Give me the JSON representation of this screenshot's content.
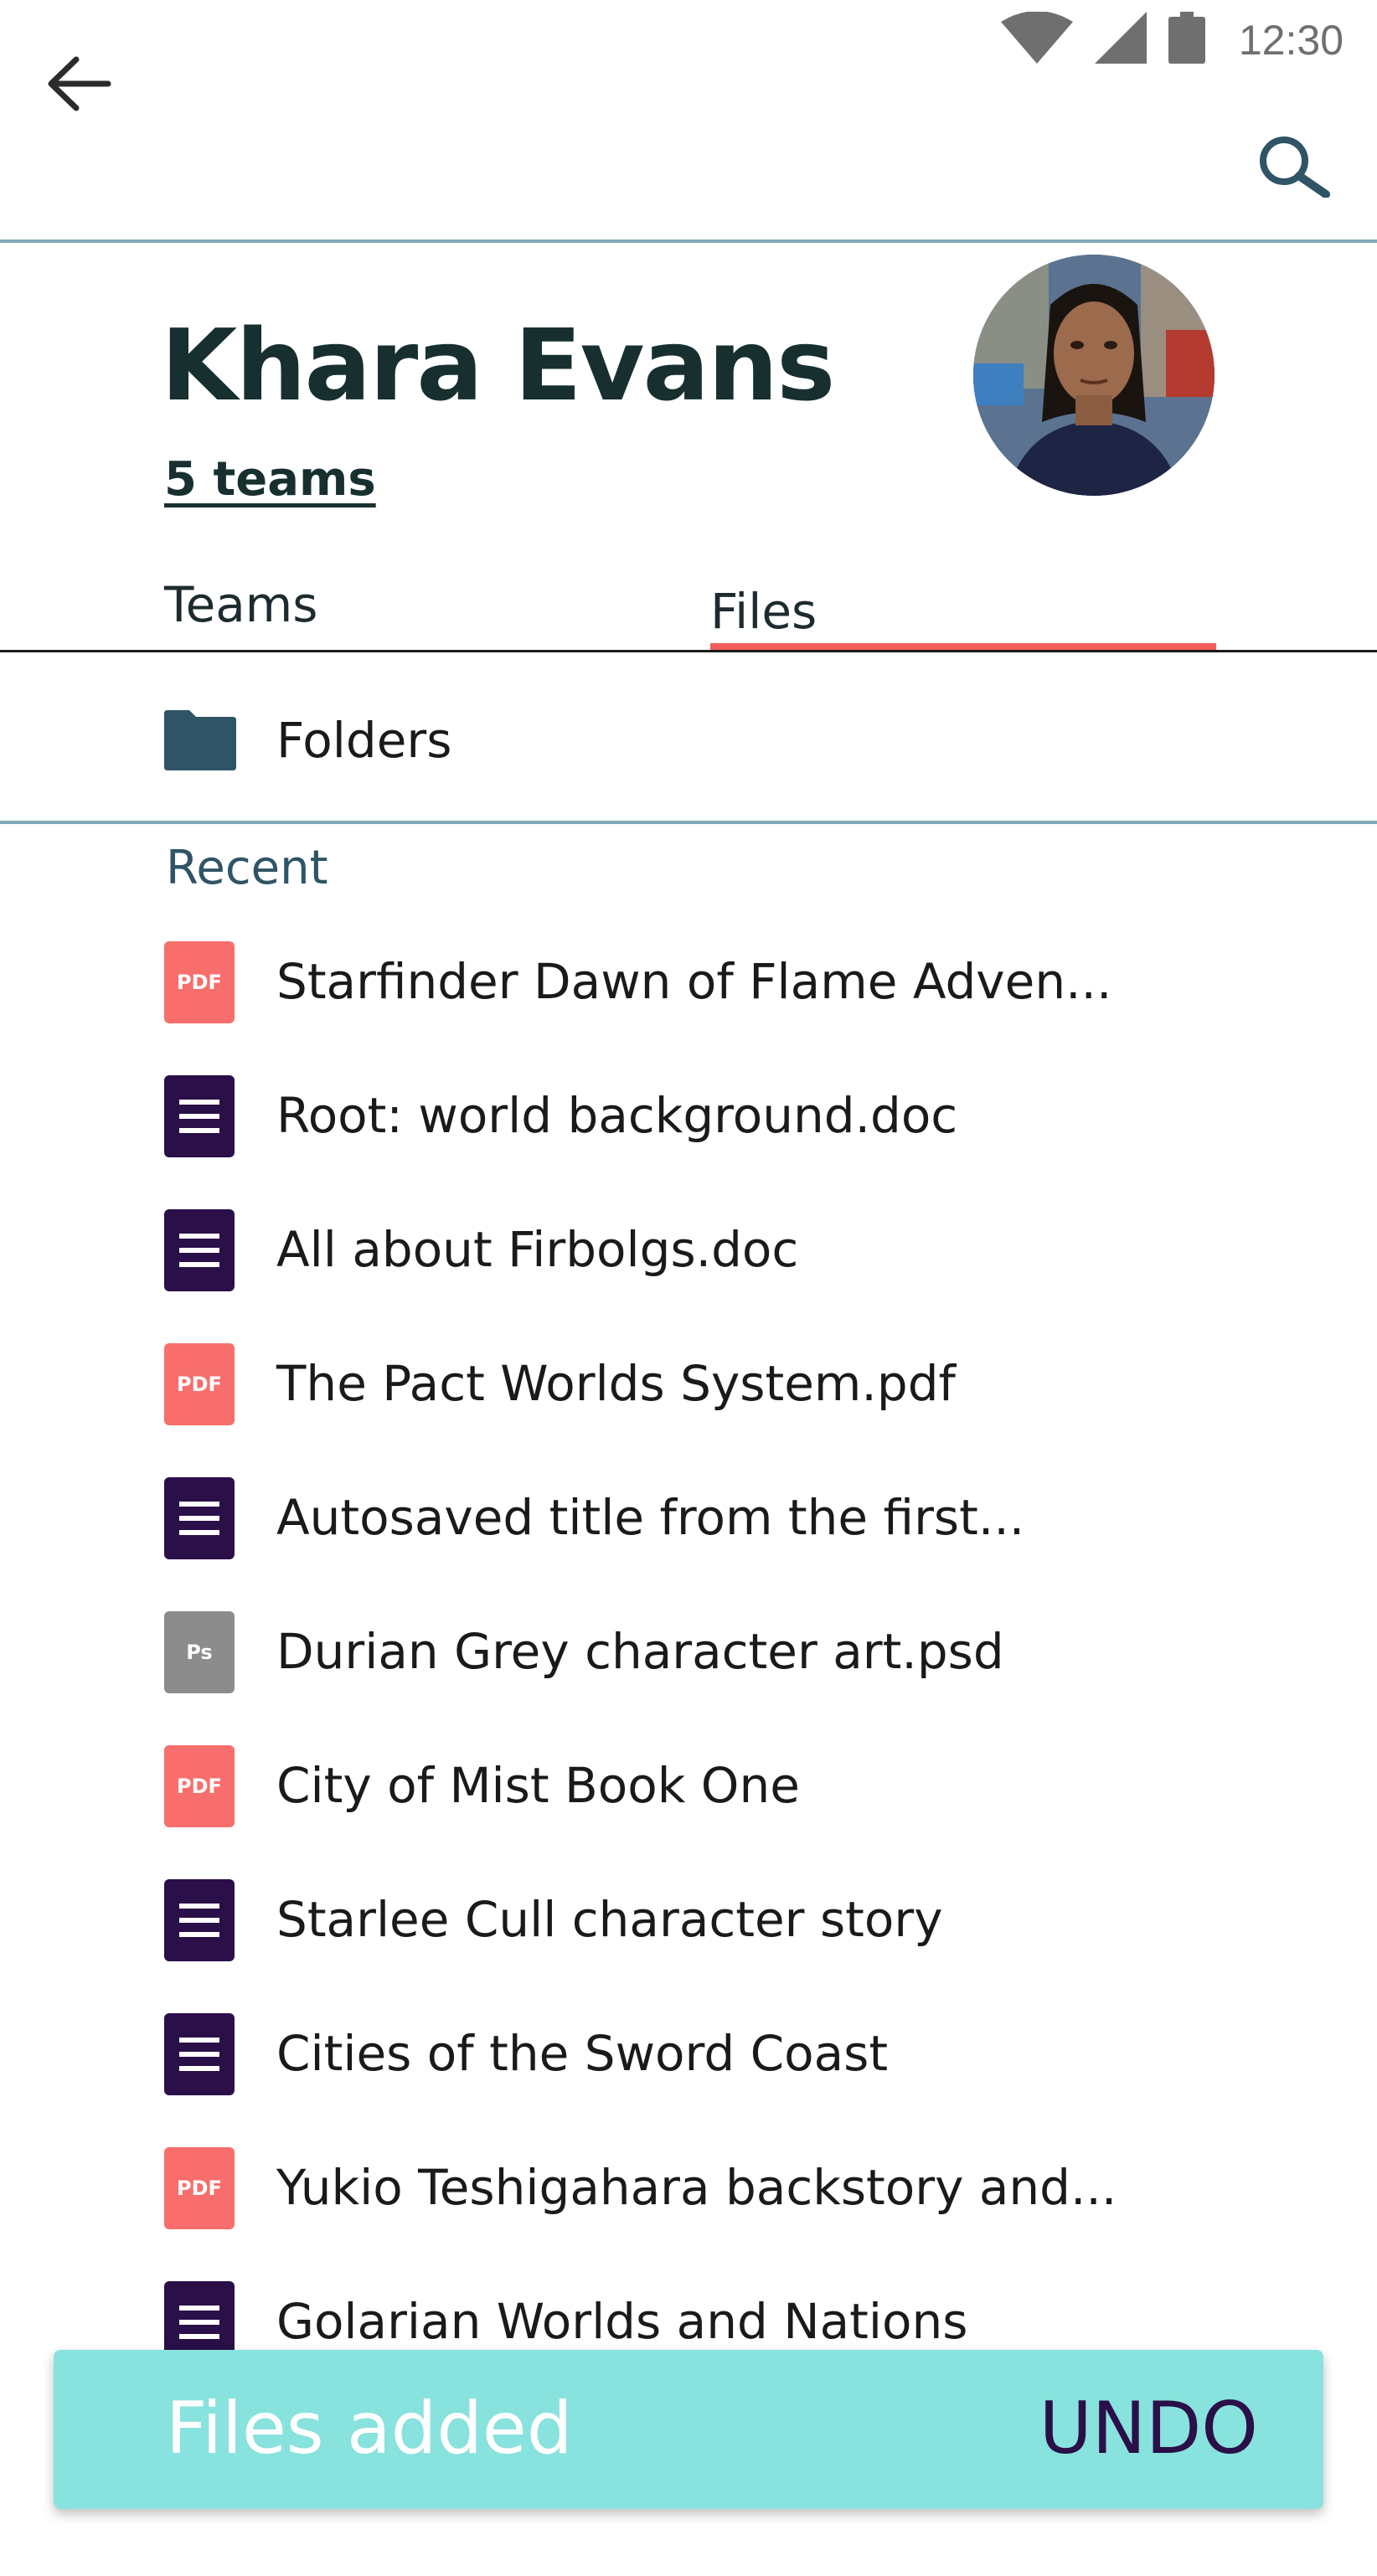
{
  "status_bar": {
    "time": "12:30",
    "icons": [
      "wifi-icon",
      "cellular-signal-icon",
      "battery-icon"
    ]
  },
  "app_bar": {
    "back_icon": "arrow-left-icon",
    "search_icon": "search-icon"
  },
  "profile": {
    "name": "Khara Evans",
    "teams_link": "5 teams",
    "avatar": "profile-photo"
  },
  "tabs": [
    {
      "label": "Teams",
      "selected": false
    },
    {
      "label": "Files",
      "selected": true
    }
  ],
  "folders": {
    "label": "Folders",
    "icon": "folder-icon"
  },
  "recent": {
    "header": "Recent",
    "files": [
      {
        "name": "Starfinder Dawn of Flame Adven...",
        "type": "pdf",
        "badge": "PDF"
      },
      {
        "name": "Root: world background.doc",
        "type": "doc",
        "badge": ""
      },
      {
        "name": "All about Firbolgs.doc",
        "type": "doc",
        "badge": ""
      },
      {
        "name": "The Pact Worlds System.pdf",
        "type": "pdf",
        "badge": "PDF"
      },
      {
        "name": "Autosaved title from the first...",
        "type": "doc",
        "badge": ""
      },
      {
        "name": "Durian Grey character art.psd",
        "type": "psd",
        "badge": "Ps"
      },
      {
        "name": "City of Mist Book One",
        "type": "pdf",
        "badge": "PDF"
      },
      {
        "name": "Starlee Cull character story",
        "type": "doc",
        "badge": ""
      },
      {
        "name": "Cities of the Sword Coast",
        "type": "doc",
        "badge": ""
      },
      {
        "name": "Yukio Teshigahara backstory and...",
        "type": "pdf",
        "badge": "PDF"
      },
      {
        "name": "Golarian Worlds and Nations",
        "type": "doc",
        "badge": ""
      }
    ]
  },
  "snackbar": {
    "message": "Files added",
    "action": "UNDO"
  },
  "colors": {
    "accent_tab": "#f25f5c",
    "divider": "#7fa9b4",
    "pdf": "#f76e6c",
    "doc": "#2a0f48",
    "psd": "#8c8c8c",
    "snackbar_bg": "#88e2dd",
    "title": "#17302f"
  }
}
